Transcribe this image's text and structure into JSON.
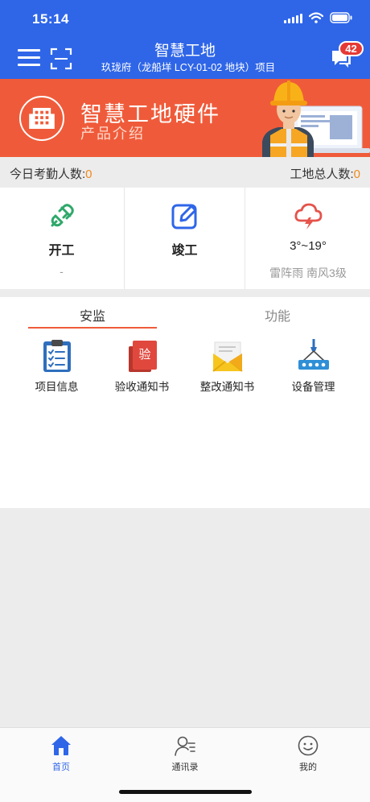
{
  "status_bar": {
    "time": "15:14"
  },
  "header": {
    "title": "智慧工地",
    "subtitle": "玖珑府（龙船垟 LCY-01-02 地块）项目",
    "message_badge": "42"
  },
  "banner": {
    "title": "智慧工地硬件",
    "subtitle": "产品介绍"
  },
  "counts": {
    "today_label": "今日考勤人数:",
    "today_value": "0",
    "total_label": "工地总人数:",
    "total_value": "0"
  },
  "status_cards": [
    {
      "icon": "plug-icon",
      "label": "开工",
      "sub": "-"
    },
    {
      "icon": "edit-icon",
      "label": "竣工",
      "sub": ""
    },
    {
      "icon": "thunderstorm-icon",
      "label": "3°~19°",
      "sub": "雷阵雨 南风3级"
    }
  ],
  "tabs": [
    {
      "label": "安监",
      "active": true
    },
    {
      "label": "功能",
      "active": false
    }
  ],
  "grid": [
    {
      "icon": "clipboard-icon",
      "label": "项目信息"
    },
    {
      "icon": "acceptance-icon",
      "label": "验收通知书",
      "glyph": "验"
    },
    {
      "icon": "envelope-icon",
      "label": "整改通知书"
    },
    {
      "icon": "crane-icon",
      "label": "设备管理"
    }
  ],
  "tabbar": [
    {
      "icon": "home-icon",
      "label": "首页",
      "active": true
    },
    {
      "icon": "contacts-icon",
      "label": "通讯录",
      "active": false
    },
    {
      "icon": "smile-icon",
      "label": "我的",
      "active": false
    }
  ],
  "colors": {
    "brand_blue": "#2f66e8",
    "banner_orange": "#ef5b3a",
    "count_orange": "#f08a1c"
  }
}
